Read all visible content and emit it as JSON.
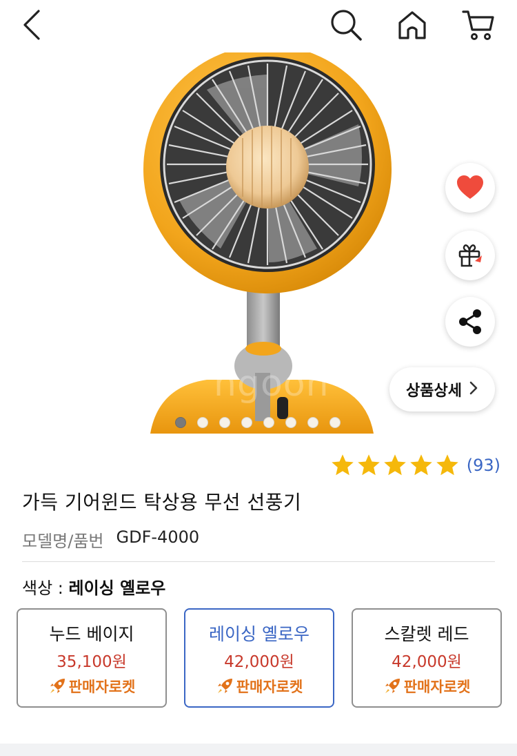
{
  "header": {
    "back_icon": "chevron-left-icon",
    "search_icon": "search-icon",
    "home_icon": "home-icon",
    "cart_icon": "cart-icon"
  },
  "gallery": {
    "slide_count": 8,
    "active_index": 0,
    "watermark": "ngoon"
  },
  "floating_actions": {
    "like_icon": "heart-icon",
    "gift_icon": "gift-icon",
    "share_icon": "share-icon",
    "detail_label": "상품상세"
  },
  "rating": {
    "stars": 5,
    "count": "(93)"
  },
  "product": {
    "title": "가득 기어윈드 탁상용 무선 선풍기",
    "model_label": "모델명/품번",
    "model_value": "GDF-4000"
  },
  "color": {
    "label": "색상 : ",
    "selected": "레이싱 옐로우"
  },
  "options": [
    {
      "name": "누드 베이지",
      "price": "35,100원",
      "badge": "판매자로켓",
      "selected": false
    },
    {
      "name": "레이싱 옐로우",
      "price": "42,000원",
      "badge": "판매자로켓",
      "selected": true
    },
    {
      "name": "스칼렛 레드",
      "price": "42,000원",
      "badge": "판매자로켓",
      "selected": false
    }
  ],
  "colors": {
    "accent_blue": "#3a66c4",
    "price_red": "#c8392b",
    "rocket_orange": "#e2721a",
    "heart_red": "#ef4b3c",
    "star_yellow": "#f5b80b",
    "fan_yellow": "#f2a51c"
  }
}
